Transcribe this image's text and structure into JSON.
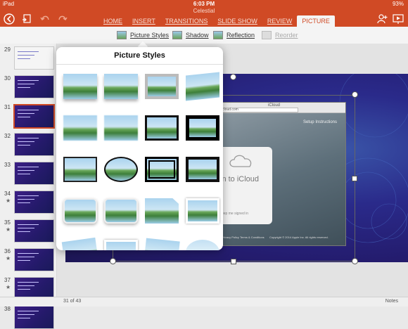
{
  "status": {
    "device": "iPad",
    "time": "6:03 PM",
    "battery": "93%"
  },
  "doc_title": "Celestial",
  "tabs": [
    "HOME",
    "INSERT",
    "TRANSITIONS",
    "SLIDE SHOW",
    "REVIEW",
    "PICTURE"
  ],
  "active_tab": "PICTURE",
  "ribbon": {
    "picture_styles": "Picture Styles",
    "shadow": "Shadow",
    "reflection": "Reflection",
    "reorder": "Reorder"
  },
  "slides": [
    {
      "n": "29",
      "star": false
    },
    {
      "n": "30",
      "star": false
    },
    {
      "n": "31",
      "star": false
    },
    {
      "n": "32",
      "star": false
    },
    {
      "n": "33",
      "star": false
    },
    {
      "n": "34",
      "star": true
    },
    {
      "n": "35",
      "star": true
    },
    {
      "n": "36",
      "star": true
    },
    {
      "n": "37",
      "star": true
    },
    {
      "n": "38",
      "star": false
    }
  ],
  "popover": {
    "title": "Picture Styles"
  },
  "slide_shot": {
    "tab_label": "iCloud",
    "url": "www.icloud.com",
    "setup": "Setup Instructions",
    "signin": "in to iCloud",
    "keep": "eep me signed in",
    "privacy": "Privacy Policy",
    "terms": "Terms & Conditions",
    "copyright": "Copyright © 2014 Apple Inc. All rights reserved."
  },
  "footer": {
    "count": "31 of 43",
    "notes": "Notes"
  },
  "colors": {
    "accent": "#d04a25",
    "slide_bg": "#2a2a8a"
  }
}
